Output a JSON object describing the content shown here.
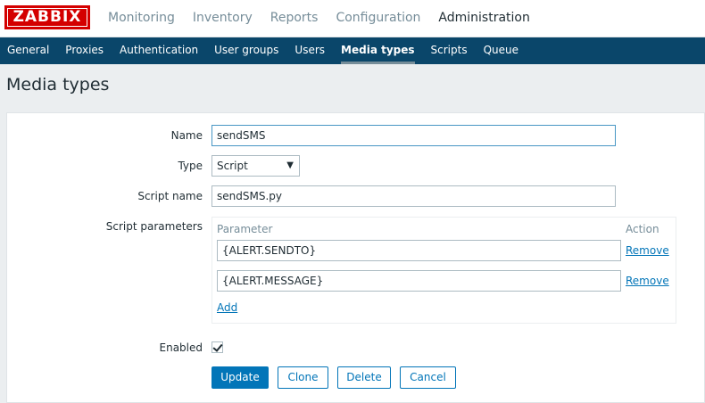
{
  "logo": "ZABBIX",
  "topnav": [
    "Monitoring",
    "Inventory",
    "Reports",
    "Configuration",
    "Administration"
  ],
  "subnav": [
    "General",
    "Proxies",
    "Authentication",
    "User groups",
    "Users",
    "Media types",
    "Scripts",
    "Queue"
  ],
  "page_title": "Media types",
  "form": {
    "name_label": "Name",
    "name_value": "sendSMS",
    "type_label": "Type",
    "type_value": "Script",
    "script_name_label": "Script name",
    "script_name_value": "sendSMS.py",
    "script_params_label": "Script parameters",
    "params_header_parameter": "Parameter",
    "params_header_action": "Action",
    "params": [
      {
        "value": "{ALERT.SENDTO}",
        "action": "Remove"
      },
      {
        "value": "{ALERT.MESSAGE}",
        "action": "Remove"
      }
    ],
    "add_label": "Add",
    "enabled_label": "Enabled",
    "enabled": true
  },
  "buttons": {
    "update": "Update",
    "clone": "Clone",
    "delete": "Delete",
    "cancel": "Cancel"
  }
}
